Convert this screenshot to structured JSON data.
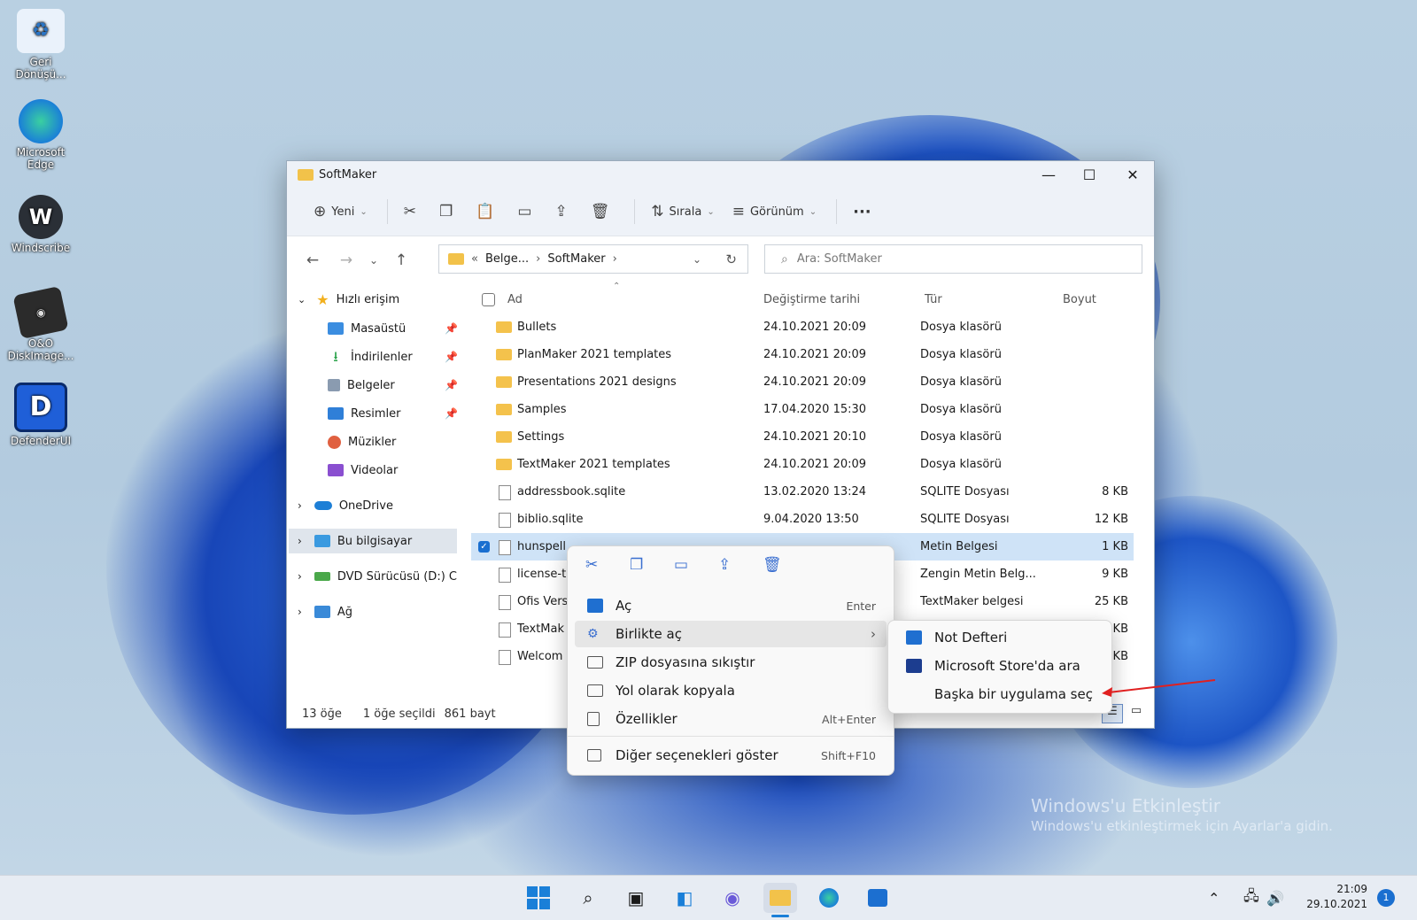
{
  "desktop": {
    "icons": [
      {
        "label": "Geri Dönüşü...",
        "icon": "recycle-bin-icon"
      },
      {
        "label": "Microsoft Edge",
        "icon": "edge-icon"
      },
      {
        "label": "Windscribe",
        "icon": "windscribe-icon"
      },
      {
        "label": "O&O DiskImage...",
        "icon": "diskimage-icon"
      },
      {
        "label": "DefenderUI",
        "icon": "defenderui-icon"
      }
    ],
    "watermark": {
      "title": "Windows'u Etkinleştir",
      "subtitle": "Windows'u etkinleştirmek için Ayarlar'a gidin."
    }
  },
  "window": {
    "title": "SoftMaker",
    "toolbar": {
      "new_label": "Yeni",
      "sort_label": "Sırala",
      "view_label": "Görünüm",
      "more_label": "···"
    },
    "address": {
      "crumb_root": "Belge...",
      "crumb_current": "SoftMaker",
      "sep": "›",
      "prefix": "«"
    },
    "search": {
      "placeholder": "Ara: SoftMaker"
    },
    "sidebar": {
      "quick_access": "Hızlı erişim",
      "items": [
        {
          "label": "Masaüstü",
          "color": "#3b8de0"
        },
        {
          "label": "İndirilenler",
          "color": "#2aa24a"
        },
        {
          "label": "Belgeler",
          "color": "#8a9bb0"
        },
        {
          "label": "Resimler",
          "color": "#2f7fd8"
        },
        {
          "label": "Müzikler",
          "color": "#e06040"
        },
        {
          "label": "Videolar",
          "color": "#8a4fd0"
        }
      ],
      "onedrive": "OneDrive",
      "this_pc": "Bu bilgisayar",
      "dvd": "DVD Sürücüsü (D:) C",
      "network": "Ağ"
    },
    "columns": {
      "name": "Ad",
      "date": "Değiştirme tarihi",
      "type": "Tür",
      "size": "Boyut"
    },
    "files": [
      {
        "name": "Bullets",
        "date": "24.10.2021 20:09",
        "type": "Dosya klasörü",
        "size": "",
        "kind": "folder"
      },
      {
        "name": "PlanMaker 2021 templates",
        "date": "24.10.2021 20:09",
        "type": "Dosya klasörü",
        "size": "",
        "kind": "folder"
      },
      {
        "name": "Presentations 2021 designs",
        "date": "24.10.2021 20:09",
        "type": "Dosya klasörü",
        "size": "",
        "kind": "folder"
      },
      {
        "name": "Samples",
        "date": "17.04.2020 15:30",
        "type": "Dosya klasörü",
        "size": "",
        "kind": "folder"
      },
      {
        "name": "Settings",
        "date": "24.10.2021 20:10",
        "type": "Dosya klasörü",
        "size": "",
        "kind": "folder"
      },
      {
        "name": "TextMaker 2021 templates",
        "date": "24.10.2021 20:09",
        "type": "Dosya klasörü",
        "size": "",
        "kind": "folder"
      },
      {
        "name": "addressbook.sqlite",
        "date": "13.02.2020 13:24",
        "type": "SQLITE Dosyası",
        "size": "8 KB",
        "kind": "file"
      },
      {
        "name": "biblio.sqlite",
        "date": "9.04.2020 13:50",
        "type": "SQLITE Dosyası",
        "size": "12 KB",
        "kind": "file"
      },
      {
        "name": "hunspell",
        "date": "",
        "type": "Metin Belgesi",
        "size": "1 KB",
        "kind": "file"
      },
      {
        "name": "license-t",
        "date": "",
        "type": "Zengin Metin Belg...",
        "size": "9 KB",
        "kind": "file"
      },
      {
        "name": "Ofis Vers",
        "date": "",
        "type": "TextMaker belgesi",
        "size": "25 KB",
        "kind": "file"
      },
      {
        "name": "TextMak",
        "date": "",
        "type": "",
        "size": "3 KB",
        "kind": "file"
      },
      {
        "name": "Welcom",
        "date": "",
        "type": "",
        "size": "5 KB",
        "kind": "file"
      }
    ],
    "status": {
      "count": "13 öğe",
      "selected": "1 öğe seçildi",
      "size": "861 bayt"
    }
  },
  "context_menu": {
    "items": [
      {
        "label": "Aç",
        "shortcut": "Enter"
      },
      {
        "label": "Birlikte aç",
        "shortcut": "›"
      },
      {
        "label": "ZIP dosyasına sıkıştır",
        "shortcut": ""
      },
      {
        "label": "Yol olarak kopyala",
        "shortcut": ""
      },
      {
        "label": "Özellikler",
        "shortcut": "Alt+Enter"
      },
      {
        "label": "Diğer seçenekleri göster",
        "shortcut": "Shift+F10"
      }
    ],
    "submenu": [
      {
        "label": "Not Defteri"
      },
      {
        "label": "Microsoft Store'da ara"
      },
      {
        "label": "Başka bir uygulama seç"
      }
    ]
  },
  "taskbar": {
    "time": "21:09",
    "date": "29.10.2021",
    "notifications": "1"
  },
  "colors": {
    "accent": "#0067c0",
    "arrow": "#e02020",
    "selection": "#cfe3f7"
  }
}
